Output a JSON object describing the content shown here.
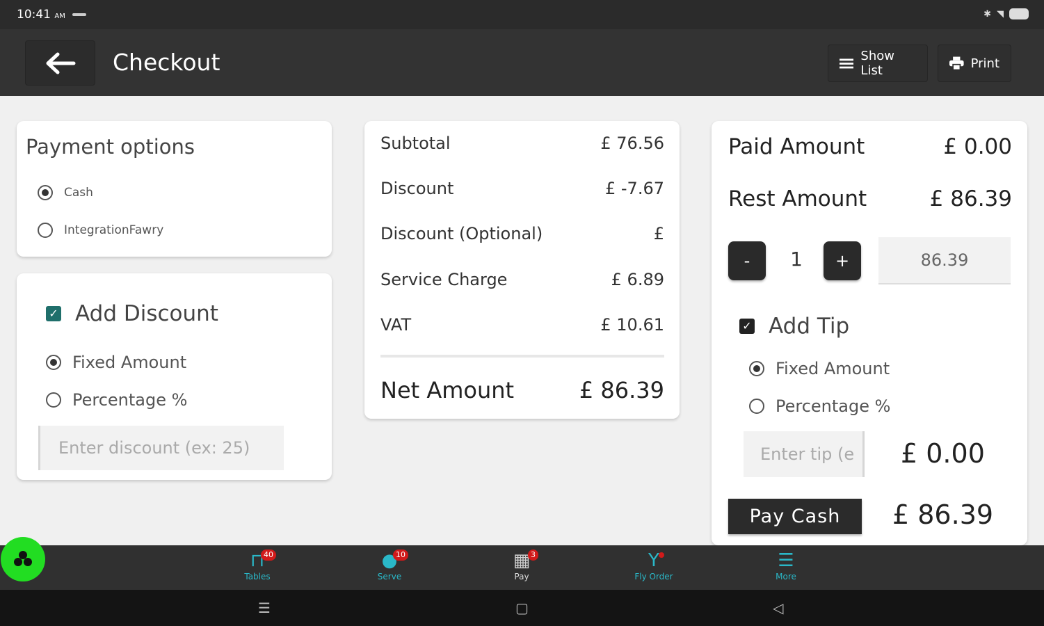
{
  "status_bar": {
    "time": "10:41",
    "ampm": "AM"
  },
  "header": {
    "title": "Checkout",
    "show_list_label": "Show List",
    "print_label": "Print"
  },
  "payment_options": {
    "title": "Payment options",
    "options": [
      {
        "label": "Cash",
        "selected": true
      },
      {
        "label": "IntegrationFawry",
        "selected": false
      }
    ]
  },
  "discount": {
    "title": "Add Discount",
    "checked": true,
    "options": [
      {
        "label": "Fixed Amount",
        "selected": true
      },
      {
        "label": "Percentage %",
        "selected": false
      }
    ],
    "input_placeholder": "Enter discount (ex: 25)"
  },
  "summary": {
    "rows": [
      {
        "label": "Subtotal",
        "value": "£ 76.56"
      },
      {
        "label": "Discount",
        "value": "£ -7.67"
      },
      {
        "label": "Discount (Optional)",
        "value": "£"
      },
      {
        "label": "Service Charge",
        "value": "£ 6.89"
      },
      {
        "label": "VAT",
        "value": "£ 10.61"
      }
    ],
    "net_label": "Net Amount",
    "net_value": "£ 86.39"
  },
  "payment": {
    "paid_label": "Paid Amount",
    "paid_value": "£ 0.00",
    "rest_label": "Rest Amount",
    "rest_value": "£ 86.39",
    "minus_label": "-",
    "plus_label": "+",
    "quantity": "1",
    "amount_value": "86.39",
    "tip_title": "Add Tip",
    "tip_checked": true,
    "tip_options": [
      {
        "label": "Fixed Amount",
        "selected": true
      },
      {
        "label": "Percentage %",
        "selected": false
      }
    ],
    "tip_placeholder": "Enter tip (e",
    "tip_value": "£ 0.00",
    "pay_button_label": "Pay Cash",
    "pay_total": "£ 86.39"
  },
  "bottom_nav": {
    "items": [
      {
        "label": "Tables",
        "badge": "40",
        "icon": "tables-icon"
      },
      {
        "label": "Serve",
        "badge": "10",
        "icon": "serve-icon"
      },
      {
        "label": "Pay",
        "badge": "3",
        "icon": "pay-icon"
      },
      {
        "label": "Fly Order",
        "badge": "",
        "icon": "fly-order-icon"
      },
      {
        "label": "More",
        "badge": "",
        "icon": "menu-icon"
      }
    ]
  },
  "colors": {
    "accent": "#2ab8c8",
    "checkbox": "#1f6f6b",
    "badge": "#d11a1a",
    "fab": "#22dd22",
    "appbar": "#333333"
  }
}
